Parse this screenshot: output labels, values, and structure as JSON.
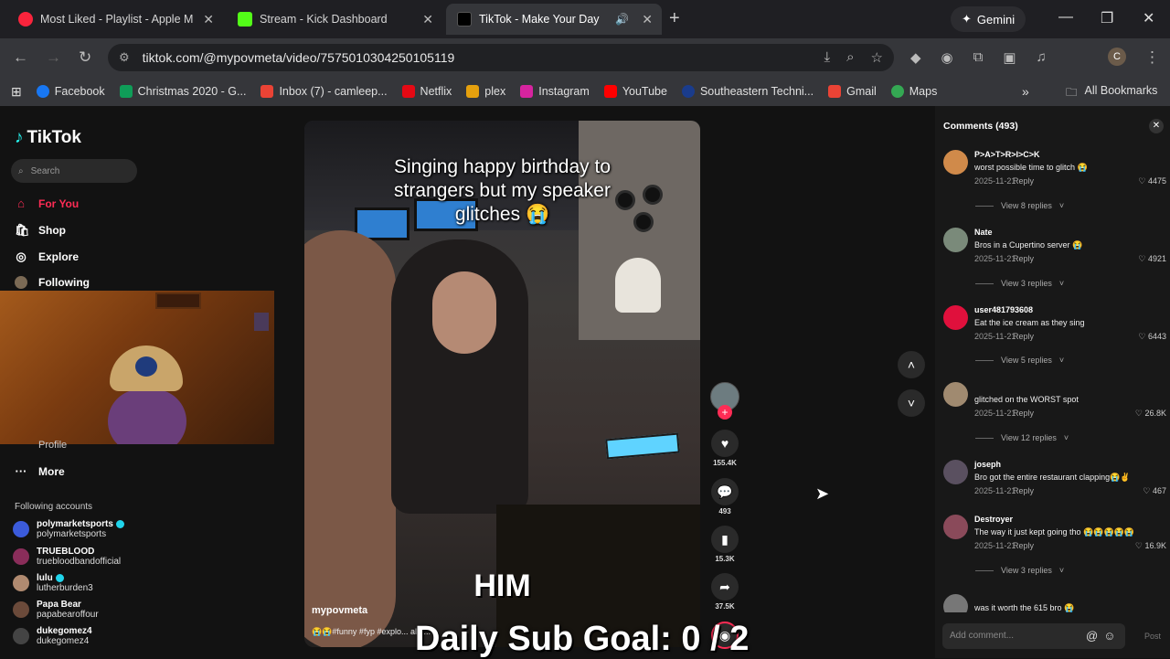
{
  "browser": {
    "tabs": [
      {
        "title": "Most Liked - Playlist - Apple M",
        "fav": "#fa243c"
      },
      {
        "title": "Stream - Kick Dashboard",
        "fav": "#53fc18"
      },
      {
        "title": "TikTok - Make Your Day",
        "fav": "#000000"
      }
    ],
    "gemini": "Gemini",
    "url": "tiktok.com/@mypovmeta/video/7575010304250105119",
    "profile_initial": "C",
    "bookmarks": [
      {
        "label": "Facebook",
        "color": "#1877f2"
      },
      {
        "label": "Christmas 2020 - G...",
        "color": "#0f9d58"
      },
      {
        "label": "Inbox (7) - camleep...",
        "color": "#ea4335"
      },
      {
        "label": "Netflix",
        "color": "#e50914"
      },
      {
        "label": "plex",
        "color": "#e5a00d"
      },
      {
        "label": "Instagram",
        "color": "#d6249f"
      },
      {
        "label": "YouTube",
        "color": "#ff0000"
      },
      {
        "label": "Southeastern Techni...",
        "color": "#1a3c8c"
      },
      {
        "label": "Gmail",
        "color": "#ea4335"
      },
      {
        "label": "Maps",
        "color": "#34a853"
      }
    ],
    "all_bookmarks": "All Bookmarks"
  },
  "sidebar": {
    "logo": "TikTok",
    "search_placeholder": "Search",
    "nav": [
      {
        "label": "For You",
        "icon": "home-icon"
      },
      {
        "label": "Shop",
        "icon": "shop-icon"
      },
      {
        "label": "Explore",
        "icon": "compass-icon"
      },
      {
        "label": "Following",
        "icon": "following-icon"
      }
    ],
    "profile_peek": "Profile",
    "more": "More",
    "following_title": "Following accounts",
    "accounts": [
      {
        "name": "polymarketsports",
        "handle": "polymarketsports",
        "color": "#3b5bdb"
      },
      {
        "name": "TRUEBLOOD",
        "handle": "truebloodbandofficial",
        "color": "#8a2d5a"
      },
      {
        "name": "lulu",
        "handle": "lutherburden3",
        "color": "#b08a70"
      },
      {
        "name": "Papa Bear",
        "handle": "papabearoffour",
        "color": "#6b4a3a"
      },
      {
        "name": "dukegomez4",
        "handle": "dukegomez4",
        "color": "#444444"
      }
    ]
  },
  "video": {
    "caption": "Singing happy birthday to strangers but my speaker glitches 😭",
    "overlay_text": "HIM",
    "author": "mypovmeta",
    "tags": "😭😭#funny #fyp #explo... al #...",
    "likes": "155.4K",
    "comments": "493",
    "saves": "15.3K",
    "shares": "37.5K"
  },
  "stream_overlay": "Daily Sub Goal:  0 / 2",
  "comments_panel": {
    "title": "Comments (493)",
    "items": [
      {
        "user": "P>A>T>R>I>C>K",
        "text": "worst possible time to glitch 😭",
        "date": "2025-11-21",
        "likes": "4475",
        "replies": "View 8 replies",
        "color": "#d08a4a"
      },
      {
        "user": "Nate",
        "text": "Bros in a Cupertino server 😭",
        "date": "2025-11-21",
        "likes": "4921",
        "replies": "View 3 replies",
        "color": "#7a8a7a"
      },
      {
        "user": "user481793608",
        "text": "Eat the ice cream as they sing",
        "date": "2025-11-21",
        "likes": "6443",
        "replies": "View 5 replies",
        "color": "#e0103c"
      },
      {
        "user": "",
        "text": "glitched on the WORST spot",
        "date": "2025-11-21",
        "likes": "26.8K",
        "replies": "View 12 replies",
        "color": "#a08a70"
      },
      {
        "user": "joseph",
        "text": "Bro got the entire restaurant clapping😭✌",
        "date": "2025-11-21",
        "likes": "467",
        "replies": "",
        "color": "#5a5060"
      },
      {
        "user": "Destroyer",
        "text": "The way it just kept going tho 😭😭😭😭😭",
        "date": "2025-11-21",
        "likes": "16.9K",
        "replies": "View 3 replies",
        "color": "#8a4a5a"
      },
      {
        "user": "",
        "text": "was it worth the 615 bro 😭",
        "date": "",
        "likes": "",
        "replies": "",
        "color": "#777777"
      }
    ],
    "reply_label": "Reply",
    "add_placeholder": "Add comment...",
    "post": "Post"
  }
}
